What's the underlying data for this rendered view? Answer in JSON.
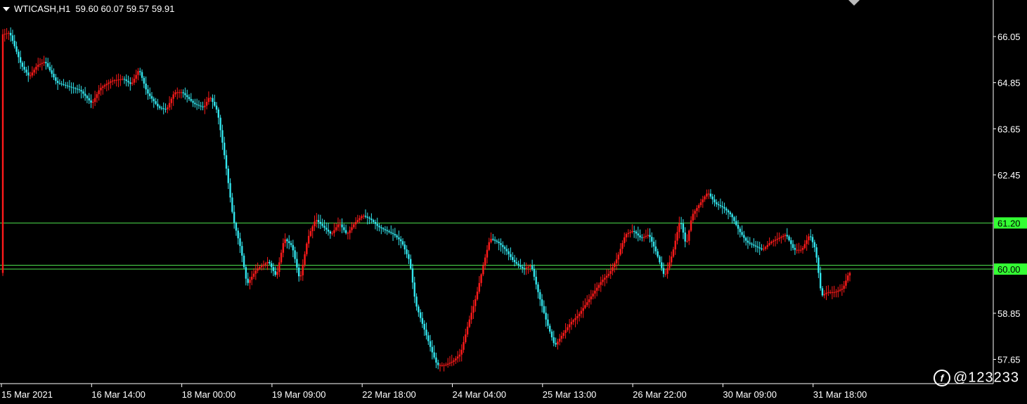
{
  "header": {
    "symbol": "WTICASH,H1",
    "ohlc": "59.60 60.07 59.57 59.91"
  },
  "watermark": {
    "text": "@123233"
  },
  "colors": {
    "background": "#000000",
    "bull_candle": "#ff1a1a",
    "bear_candle": "#33e6ee",
    "hline": "#4ce04c",
    "hline_label_bg": "#33ff33",
    "axis": "#ffffff",
    "text": "#ffffff"
  },
  "chart_data": {
    "type": "candlestick",
    "symbol": "WTICASH",
    "timeframe": "H1",
    "ylim": [
      57.02,
      67.0
    ],
    "y_ticks": [
      "66.05",
      "64.85",
      "63.65",
      "62.45",
      "58.85",
      "57.65"
    ],
    "x_ticks": [
      "15 Mar 2021",
      "16 Mar 14:00",
      "18 Mar 00:00",
      "19 Mar 09:00",
      "22 Mar 18:00",
      "24 Mar 04:00",
      "25 Mar 13:00",
      "26 Mar 22:00",
      "30 Mar 09:00",
      "31 Mar 18:00"
    ],
    "horizontal_lines": [
      {
        "value": 61.2,
        "label": "61.20",
        "labeled": true
      },
      {
        "value": 60.1,
        "label": "",
        "labeled": false
      },
      {
        "value": 60.0,
        "label": "60.00",
        "labeled": true
      }
    ],
    "path_anchors": [
      [
        0,
        66.1
      ],
      [
        4,
        66.15
      ],
      [
        10,
        65.3
      ],
      [
        14,
        65.0
      ],
      [
        18,
        65.3
      ],
      [
        22,
        65.4
      ],
      [
        28,
        64.85
      ],
      [
        34,
        64.75
      ],
      [
        40,
        64.65
      ],
      [
        46,
        64.3
      ],
      [
        50,
        64.7
      ],
      [
        56,
        64.9
      ],
      [
        62,
        64.95
      ],
      [
        66,
        64.8
      ],
      [
        70,
        65.2
      ],
      [
        74,
        64.6
      ],
      [
        80,
        64.2
      ],
      [
        84,
        64.15
      ],
      [
        88,
        64.6
      ],
      [
        92,
        64.6
      ],
      [
        98,
        64.3
      ],
      [
        103,
        64.2
      ],
      [
        106,
        64.5
      ],
      [
        110,
        64.1
      ],
      [
        114,
        62.8
      ],
      [
        118,
        61.3
      ],
      [
        122,
        60.5
      ],
      [
        125,
        59.6
      ],
      [
        130,
        60.0
      ],
      [
        136,
        60.2
      ],
      [
        140,
        59.8
      ],
      [
        144,
        60.8
      ],
      [
        148,
        60.6
      ],
      [
        152,
        59.7
      ],
      [
        156,
        60.8
      ],
      [
        160,
        61.3
      ],
      [
        164,
        61.1
      ],
      [
        168,
        60.9
      ],
      [
        172,
        61.2
      ],
      [
        176,
        60.9
      ],
      [
        180,
        61.2
      ],
      [
        184,
        61.4
      ],
      [
        188,
        61.3
      ],
      [
        192,
        61.1
      ],
      [
        196,
        61.0
      ],
      [
        200,
        60.9
      ],
      [
        204,
        60.7
      ],
      [
        208,
        60.2
      ],
      [
        211,
        59.1
      ],
      [
        215,
        58.5
      ],
      [
        219,
        57.9
      ],
      [
        222,
        57.5
      ],
      [
        226,
        57.5
      ],
      [
        230,
        57.6
      ],
      [
        234,
        57.8
      ],
      [
        238,
        58.6
      ],
      [
        242,
        59.3
      ],
      [
        246,
        60.2
      ],
      [
        249,
        60.8
      ],
      [
        253,
        60.7
      ],
      [
        257,
        60.5
      ],
      [
        261,
        60.2
      ],
      [
        266,
        60.0
      ],
      [
        270,
        60.1
      ],
      [
        274,
        59.3
      ],
      [
        278,
        58.6
      ],
      [
        282,
        58.0
      ],
      [
        286,
        58.3
      ],
      [
        290,
        58.6
      ],
      [
        294,
        58.8
      ],
      [
        298,
        59.1
      ],
      [
        302,
        59.4
      ],
      [
        306,
        59.7
      ],
      [
        310,
        59.9
      ],
      [
        314,
        60.3
      ],
      [
        318,
        60.9
      ],
      [
        322,
        61.0
      ],
      [
        326,
        60.8
      ],
      [
        330,
        60.9
      ],
      [
        334,
        60.4
      ],
      [
        338,
        59.8
      ],
      [
        342,
        60.4
      ],
      [
        346,
        61.3
      ],
      [
        349,
        60.6
      ],
      [
        352,
        61.4
      ],
      [
        356,
        61.7
      ],
      [
        360,
        62.0
      ],
      [
        364,
        61.7
      ],
      [
        368,
        61.6
      ],
      [
        372,
        61.4
      ],
      [
        376,
        61.0
      ],
      [
        380,
        60.7
      ],
      [
        384,
        60.6
      ],
      [
        388,
        60.5
      ],
      [
        392,
        60.7
      ],
      [
        396,
        60.8
      ],
      [
        400,
        60.9
      ],
      [
        404,
        60.5
      ],
      [
        408,
        60.5
      ],
      [
        412,
        60.9
      ],
      [
        415,
        60.5
      ],
      [
        418,
        59.3
      ],
      [
        421,
        59.4
      ],
      [
        425,
        59.4
      ],
      [
        429,
        59.5
      ],
      [
        432,
        59.9
      ]
    ],
    "bars_plotted": 433
  }
}
